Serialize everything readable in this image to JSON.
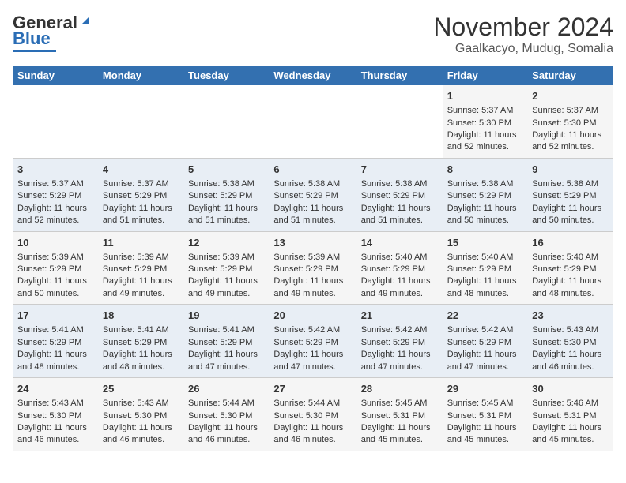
{
  "header": {
    "logo_general": "General",
    "logo_blue": "Blue",
    "month_title": "November 2024",
    "location": "Gaalkacyo, Mudug, Somalia"
  },
  "days_of_week": [
    "Sunday",
    "Monday",
    "Tuesday",
    "Wednesday",
    "Thursday",
    "Friday",
    "Saturday"
  ],
  "weeks": [
    [
      {
        "day": "",
        "sunrise": "",
        "sunset": "",
        "daylight": ""
      },
      {
        "day": "",
        "sunrise": "",
        "sunset": "",
        "daylight": ""
      },
      {
        "day": "",
        "sunrise": "",
        "sunset": "",
        "daylight": ""
      },
      {
        "day": "",
        "sunrise": "",
        "sunset": "",
        "daylight": ""
      },
      {
        "day": "",
        "sunrise": "",
        "sunset": "",
        "daylight": ""
      },
      {
        "day": "1",
        "sunrise": "Sunrise: 5:37 AM",
        "sunset": "Sunset: 5:30 PM",
        "daylight": "Daylight: 11 hours and 52 minutes."
      },
      {
        "day": "2",
        "sunrise": "Sunrise: 5:37 AM",
        "sunset": "Sunset: 5:30 PM",
        "daylight": "Daylight: 11 hours and 52 minutes."
      }
    ],
    [
      {
        "day": "3",
        "sunrise": "Sunrise: 5:37 AM",
        "sunset": "Sunset: 5:29 PM",
        "daylight": "Daylight: 11 hours and 52 minutes."
      },
      {
        "day": "4",
        "sunrise": "Sunrise: 5:37 AM",
        "sunset": "Sunset: 5:29 PM",
        "daylight": "Daylight: 11 hours and 51 minutes."
      },
      {
        "day": "5",
        "sunrise": "Sunrise: 5:38 AM",
        "sunset": "Sunset: 5:29 PM",
        "daylight": "Daylight: 11 hours and 51 minutes."
      },
      {
        "day": "6",
        "sunrise": "Sunrise: 5:38 AM",
        "sunset": "Sunset: 5:29 PM",
        "daylight": "Daylight: 11 hours and 51 minutes."
      },
      {
        "day": "7",
        "sunrise": "Sunrise: 5:38 AM",
        "sunset": "Sunset: 5:29 PM",
        "daylight": "Daylight: 11 hours and 51 minutes."
      },
      {
        "day": "8",
        "sunrise": "Sunrise: 5:38 AM",
        "sunset": "Sunset: 5:29 PM",
        "daylight": "Daylight: 11 hours and 50 minutes."
      },
      {
        "day": "9",
        "sunrise": "Sunrise: 5:38 AM",
        "sunset": "Sunset: 5:29 PM",
        "daylight": "Daylight: 11 hours and 50 minutes."
      }
    ],
    [
      {
        "day": "10",
        "sunrise": "Sunrise: 5:39 AM",
        "sunset": "Sunset: 5:29 PM",
        "daylight": "Daylight: 11 hours and 50 minutes."
      },
      {
        "day": "11",
        "sunrise": "Sunrise: 5:39 AM",
        "sunset": "Sunset: 5:29 PM",
        "daylight": "Daylight: 11 hours and 49 minutes."
      },
      {
        "day": "12",
        "sunrise": "Sunrise: 5:39 AM",
        "sunset": "Sunset: 5:29 PM",
        "daylight": "Daylight: 11 hours and 49 minutes."
      },
      {
        "day": "13",
        "sunrise": "Sunrise: 5:39 AM",
        "sunset": "Sunset: 5:29 PM",
        "daylight": "Daylight: 11 hours and 49 minutes."
      },
      {
        "day": "14",
        "sunrise": "Sunrise: 5:40 AM",
        "sunset": "Sunset: 5:29 PM",
        "daylight": "Daylight: 11 hours and 49 minutes."
      },
      {
        "day": "15",
        "sunrise": "Sunrise: 5:40 AM",
        "sunset": "Sunset: 5:29 PM",
        "daylight": "Daylight: 11 hours and 48 minutes."
      },
      {
        "day": "16",
        "sunrise": "Sunrise: 5:40 AM",
        "sunset": "Sunset: 5:29 PM",
        "daylight": "Daylight: 11 hours and 48 minutes."
      }
    ],
    [
      {
        "day": "17",
        "sunrise": "Sunrise: 5:41 AM",
        "sunset": "Sunset: 5:29 PM",
        "daylight": "Daylight: 11 hours and 48 minutes."
      },
      {
        "day": "18",
        "sunrise": "Sunrise: 5:41 AM",
        "sunset": "Sunset: 5:29 PM",
        "daylight": "Daylight: 11 hours and 48 minutes."
      },
      {
        "day": "19",
        "sunrise": "Sunrise: 5:41 AM",
        "sunset": "Sunset: 5:29 PM",
        "daylight": "Daylight: 11 hours and 47 minutes."
      },
      {
        "day": "20",
        "sunrise": "Sunrise: 5:42 AM",
        "sunset": "Sunset: 5:29 PM",
        "daylight": "Daylight: 11 hours and 47 minutes."
      },
      {
        "day": "21",
        "sunrise": "Sunrise: 5:42 AM",
        "sunset": "Sunset: 5:29 PM",
        "daylight": "Daylight: 11 hours and 47 minutes."
      },
      {
        "day": "22",
        "sunrise": "Sunrise: 5:42 AM",
        "sunset": "Sunset: 5:29 PM",
        "daylight": "Daylight: 11 hours and 47 minutes."
      },
      {
        "day": "23",
        "sunrise": "Sunrise: 5:43 AM",
        "sunset": "Sunset: 5:30 PM",
        "daylight": "Daylight: 11 hours and 46 minutes."
      }
    ],
    [
      {
        "day": "24",
        "sunrise": "Sunrise: 5:43 AM",
        "sunset": "Sunset: 5:30 PM",
        "daylight": "Daylight: 11 hours and 46 minutes."
      },
      {
        "day": "25",
        "sunrise": "Sunrise: 5:43 AM",
        "sunset": "Sunset: 5:30 PM",
        "daylight": "Daylight: 11 hours and 46 minutes."
      },
      {
        "day": "26",
        "sunrise": "Sunrise: 5:44 AM",
        "sunset": "Sunset: 5:30 PM",
        "daylight": "Daylight: 11 hours and 46 minutes."
      },
      {
        "day": "27",
        "sunrise": "Sunrise: 5:44 AM",
        "sunset": "Sunset: 5:30 PM",
        "daylight": "Daylight: 11 hours and 46 minutes."
      },
      {
        "day": "28",
        "sunrise": "Sunrise: 5:45 AM",
        "sunset": "Sunset: 5:31 PM",
        "daylight": "Daylight: 11 hours and 45 minutes."
      },
      {
        "day": "29",
        "sunrise": "Sunrise: 5:45 AM",
        "sunset": "Sunset: 5:31 PM",
        "daylight": "Daylight: 11 hours and 45 minutes."
      },
      {
        "day": "30",
        "sunrise": "Sunrise: 5:46 AM",
        "sunset": "Sunset: 5:31 PM",
        "daylight": "Daylight: 11 hours and 45 minutes."
      }
    ]
  ]
}
